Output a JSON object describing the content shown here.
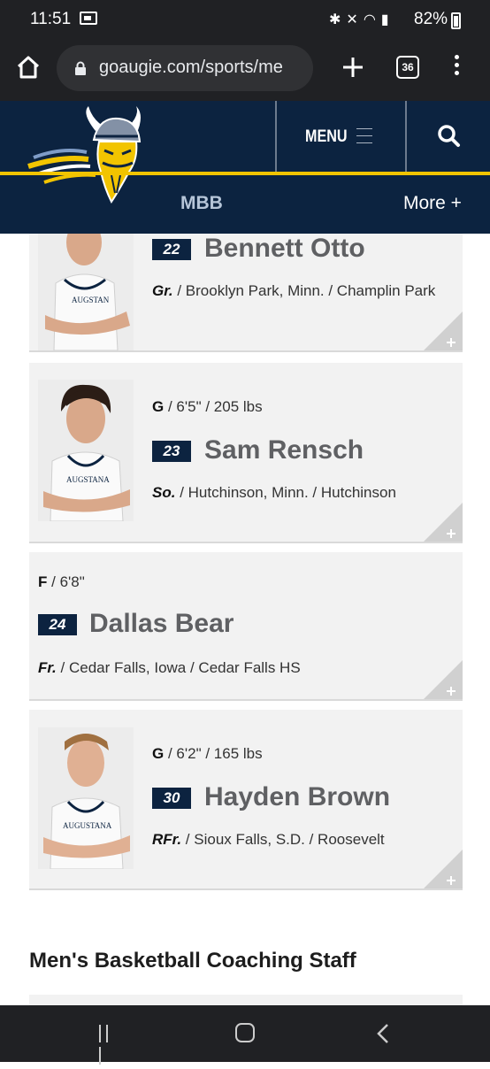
{
  "status_bar": {
    "time": "11:51",
    "battery": "82%",
    "icons": [
      "message-icon",
      "bluetooth-icon",
      "mute-icon",
      "wifi-icon",
      "signal-icon",
      "battery-icon"
    ]
  },
  "browser": {
    "url": "goaugie.com/sports/me",
    "tab_count": "36"
  },
  "site": {
    "menu_label": "MENU",
    "subnav_label": "MBB",
    "more_label": "More +",
    "colors": {
      "navy": "#0c2340",
      "gold": "#f2c400"
    }
  },
  "roster": [
    {
      "position": "",
      "height": "",
      "weight": "",
      "number": "22",
      "name": "Bennett Otto",
      "year": "Gr.",
      "hometown": "/ Brooklyn Park, Minn. / Champlin Park",
      "has_photo": true
    },
    {
      "position": "G",
      "height": "/ 6'5\"",
      "weight": "/ 205 lbs",
      "number": "23",
      "name": "Sam Rensch",
      "year": "So.",
      "hometown": "/ Hutchinson, Minn. / Hutchinson",
      "has_photo": true
    },
    {
      "position": "F",
      "height": "/ 6'8\"",
      "weight": "",
      "number": "24",
      "name": "Dallas Bear",
      "year": "Fr.",
      "hometown": "/ Cedar Falls, Iowa / Cedar Falls HS",
      "has_photo": false
    },
    {
      "position": "G",
      "height": "/ 6'2\"",
      "weight": "/ 165 lbs",
      "number": "30",
      "name": "Hayden Brown",
      "year": "RFr.",
      "hometown": "/ Sioux Falls, S.D. / Roosevelt",
      "has_photo": true
    }
  ],
  "coaching_staff_title": "Men's Basketball Coaching Staff"
}
